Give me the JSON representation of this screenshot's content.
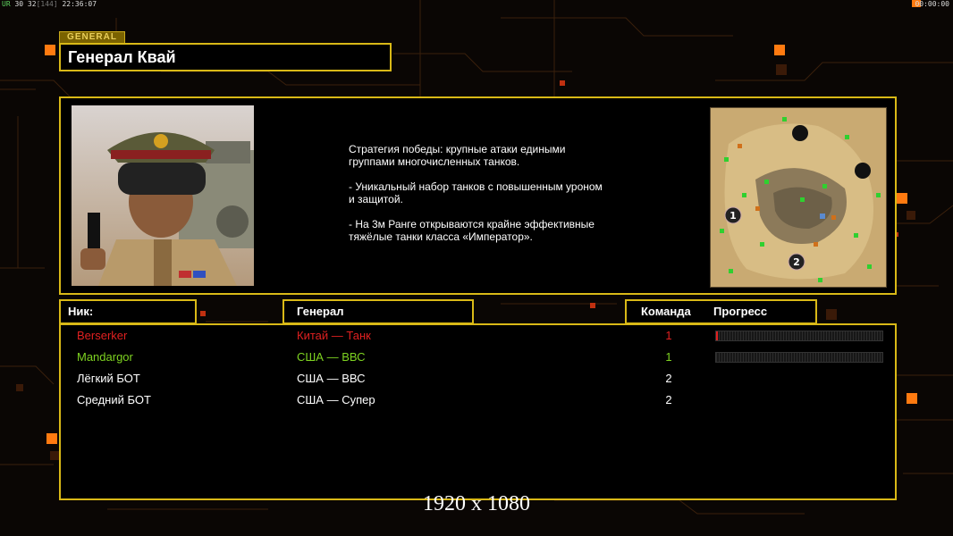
{
  "hud": {
    "left_ur": "UR",
    "left_stats": "30 32",
    "left_ping": "[144]",
    "left_time": "22:36:07",
    "right_time": "00:00:00"
  },
  "general": {
    "tag": "GENERAL",
    "name": "Генерал Квай"
  },
  "description": [
    "Стратегия победы: крупные атаки едиными\n группами многочисленных танков.",
    "- Уникальный набор танков с повышенным уроном\n и защитой.",
    "- На 3м Ранге открываются крайне эффективные\n тяжёлые танки класса «Император»."
  ],
  "minimap": {
    "start_1": "1",
    "start_2": "2"
  },
  "table": {
    "headers": {
      "nick": "Ник:",
      "general": "Генерал",
      "team": "Команда",
      "progress": "Прогресс"
    },
    "rows": [
      {
        "nick": "Berserker",
        "general": "Китай — Танк",
        "team": "1",
        "color": "#e02020",
        "progress": 0.01,
        "show_progress": true
      },
      {
        "nick": "Mandargor",
        "general": "США — ВВС",
        "team": "1",
        "color": "#7ed321",
        "progress": 0.0,
        "show_progress": true
      },
      {
        "nick": "Лёгкий БОТ",
        "general": "США — ВВС",
        "team": "2",
        "color": "#ffffff",
        "progress": 0.0,
        "show_progress": false
      },
      {
        "nick": "Средний БОТ",
        "general": "США — Супер",
        "team": "2",
        "color": "#ffffff",
        "progress": 0.0,
        "show_progress": false
      }
    ]
  },
  "caption": "1920 x 1080",
  "colors": {
    "panel_border": "#d9b917",
    "accent_orange": "#ff7a10",
    "background": "#0a0604"
  }
}
